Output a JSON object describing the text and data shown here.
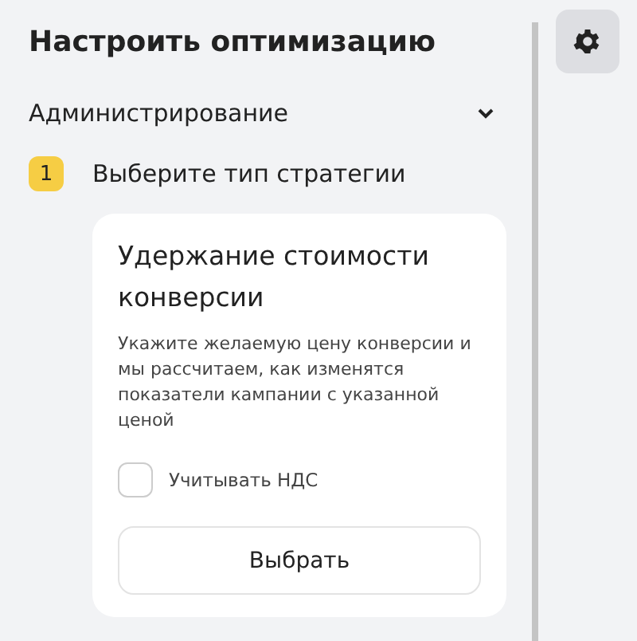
{
  "panel": {
    "title": "Настроить оптимизацию",
    "section": "Администрирование",
    "step": {
      "number": "1",
      "label": "Выберите тип стратегии"
    },
    "card": {
      "title": "Удержание стоимости конверсии",
      "description": "Укажите желаемую цену конверсии и мы рассчитаем, как изменятся показатели кампании с указанной ценой",
      "checkbox": {
        "label": "Учитывать НДС",
        "checked": false
      },
      "button": "Выбрать"
    }
  }
}
